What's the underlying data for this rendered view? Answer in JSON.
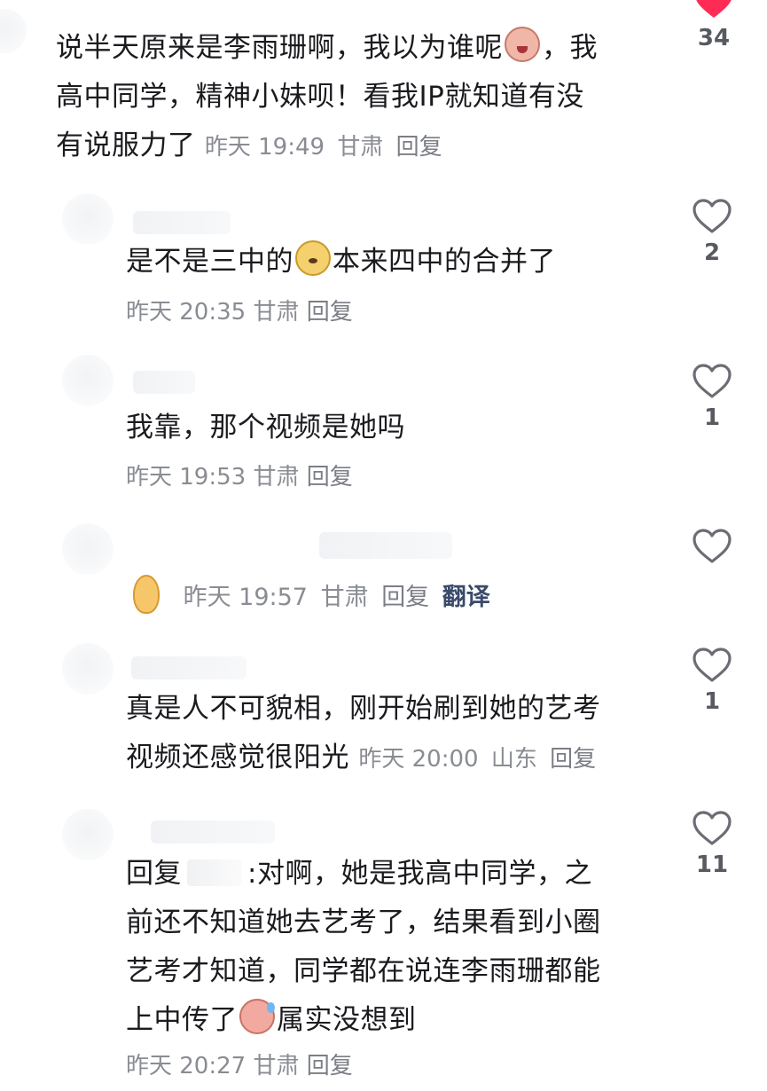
{
  "comments": [
    {
      "text_a": "说半天原来是李雨珊啊，我以为谁呢",
      "emoji_1": "crying-face-emoji",
      "text_b": "，我",
      "text_line2": "高中同学，精神小妹呗！看我IP就知道有没",
      "text_line3": "有说服力了",
      "time": "昨天 19:49",
      "location": "甘肃",
      "reply": "回复",
      "likes": "34",
      "liked": true
    },
    {
      "text_a": "是不是三中的",
      "emoji_1": "dog-face-emoji",
      "text_b": "本来四中的合并了",
      "time": "昨天 20:35",
      "location": "甘肃",
      "reply": "回复",
      "likes": "2"
    },
    {
      "text": "我靠，那个视频是她吗",
      "time": "昨天 19:53",
      "location": "甘肃",
      "reply": "回复",
      "likes": "1"
    },
    {
      "emoji_1": "ear-emoji",
      "time": "昨天 19:57",
      "location": "甘肃",
      "reply": "回复",
      "translate": "翻译",
      "likes": ""
    },
    {
      "text_line1": "真是人不可貌相，刚开始刷到她的艺考",
      "text_line2": "视频还感觉很阳光",
      "time": "昨天 20:00",
      "location": "山东",
      "reply": "回复",
      "likes": "1"
    },
    {
      "prefix": "回复",
      "text_line1": ":对啊，她是我高中同学，之",
      "text_line2": "前还不知道她去艺考了，结果看到小圈",
      "text_line3": "艺考才知道，同学都在说连李雨珊都能",
      "text_line4a": "上中传了",
      "emoji_1": "sweating-face-emoji",
      "text_line4b": "属实没想到",
      "time": "昨天 20:27",
      "location": "甘肃",
      "reply": "回复",
      "likes": "11"
    }
  ],
  "colors": {
    "text": "#1b1b1f",
    "meta": "#8a8c93",
    "liked": "#fe2c55",
    "heart_outline": "#6b6d74",
    "translate": "#3a4a6a"
  }
}
